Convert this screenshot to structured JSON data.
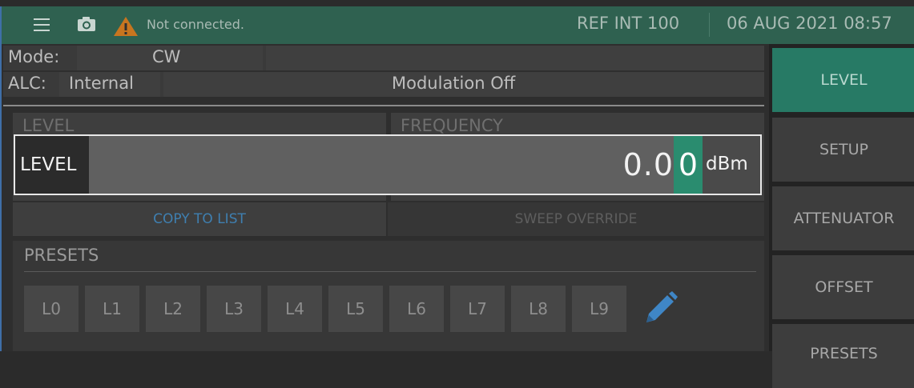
{
  "header": {
    "status": "Not connected.",
    "reference": "REF INT 100",
    "datetime": "06 AUG 2021 08:57"
  },
  "mode": {
    "label": "Mode:",
    "value": "CW"
  },
  "alc": {
    "label": "ALC:",
    "value": "Internal",
    "modulation": "Modulation Off"
  },
  "panels": {
    "level_title": "LEVEL",
    "frequency_title": "FREQUENCY"
  },
  "buttons": {
    "copy_to_list": "COPY TO LIST",
    "sweep_override": "SWEEP OVERRIDE"
  },
  "presets": {
    "title": "PRESETS",
    "items": [
      "L0",
      "L1",
      "L2",
      "L3",
      "L4",
      "L5",
      "L6",
      "L7",
      "L8",
      "L9"
    ]
  },
  "entry": {
    "label": "LEVEL",
    "value": "0.0",
    "cursor_digit": "0",
    "unit": "dBm"
  },
  "side_nav": {
    "items": [
      "LEVEL",
      "SETUP",
      "ATTENUATOR",
      "OFFSET",
      "PRESETS"
    ],
    "active": "LEVEL"
  },
  "colors": {
    "header_bg": "#2f6150",
    "accent": "#277a65",
    "cursor": "#2a8c6f",
    "link": "#3f7fb0"
  },
  "icons": [
    "menu-icon",
    "camera-icon",
    "warning-icon",
    "pencil-icon"
  ]
}
